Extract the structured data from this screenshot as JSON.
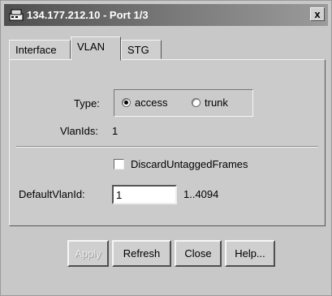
{
  "window": {
    "title": "134.177.212.10 - Port 1/3",
    "close_glyph": "x",
    "title_icon": "device-icon"
  },
  "tabs": [
    {
      "label": "Interface",
      "active": false
    },
    {
      "label": "VLAN",
      "active": true
    },
    {
      "label": "STG",
      "active": false
    }
  ],
  "vlan": {
    "type_label": "Type:",
    "type_options": [
      {
        "label": "access",
        "selected": true
      },
      {
        "label": "trunk",
        "selected": false
      }
    ],
    "vlanids_label": "VlanIds:",
    "vlanids_value": "1",
    "discard_label": "DiscardUntaggedFrames",
    "discard_checked": false,
    "default_vlan_label": "DefaultVlanId:",
    "default_vlan_value": "1",
    "default_vlan_range": "1..4094"
  },
  "buttons": {
    "apply": "Apply",
    "refresh": "Refresh",
    "close": "Close",
    "help": "Help..."
  }
}
